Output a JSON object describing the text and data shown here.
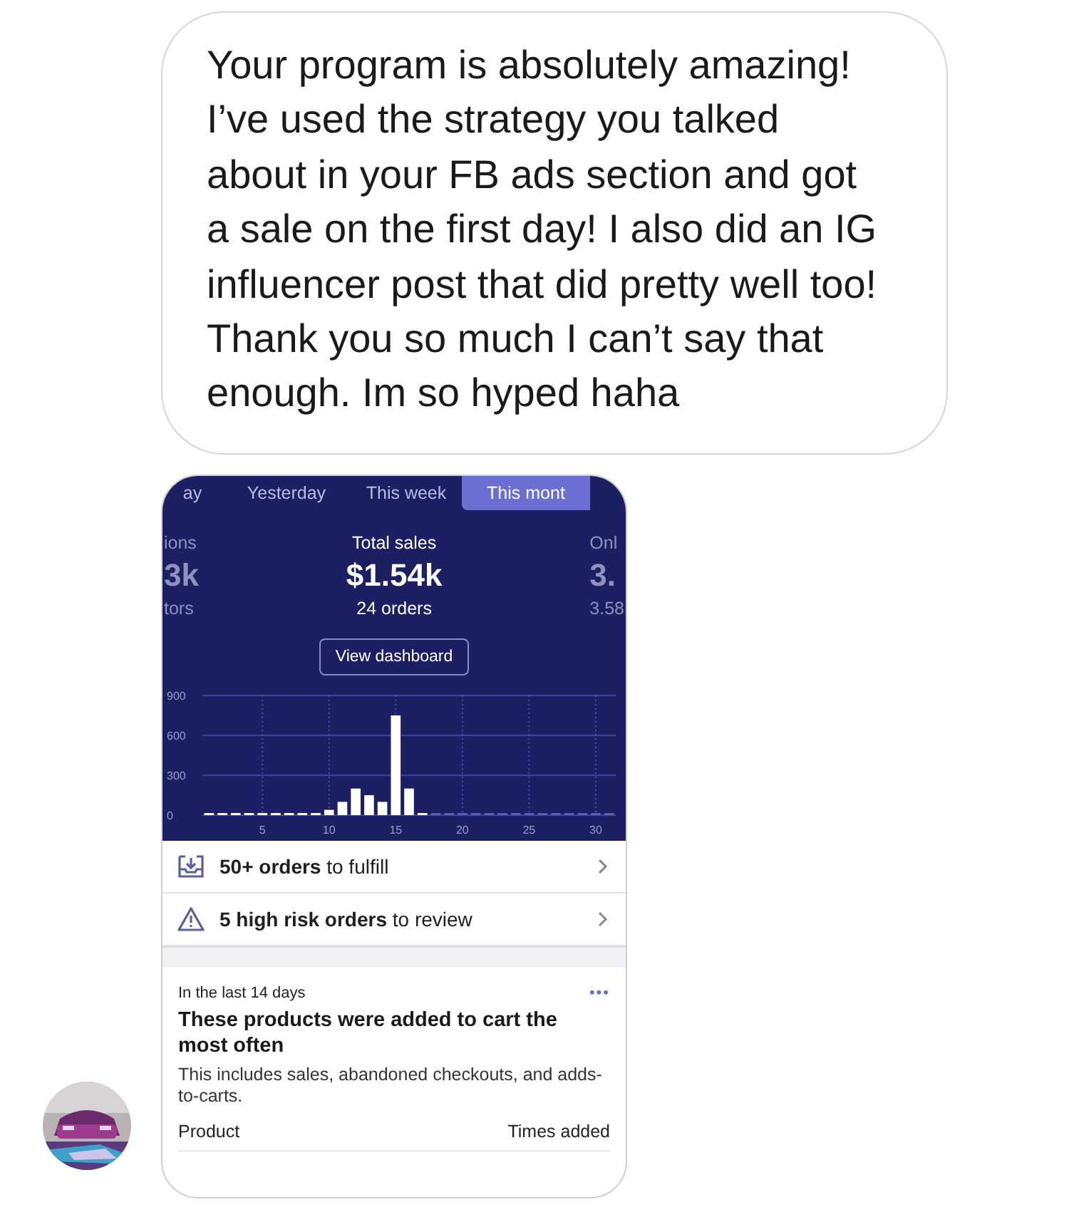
{
  "message": {
    "text": "Your program is absolutely amazing!\nI’ve used the strategy you talked about in your FB ads section and got a sale on the first day! I also did an IG influencer post that did pretty well too! Thank you so much I can’t say that enough. Im so hyped haha"
  },
  "screenshot": {
    "tabs": [
      {
        "label": "ay",
        "selected": false
      },
      {
        "label": "Yesterday",
        "selected": false
      },
      {
        "label": "This week",
        "selected": false
      },
      {
        "label": "This mont",
        "selected": true
      }
    ],
    "metrics": [
      {
        "label": "ions",
        "value": "3k",
        "sub": "tors",
        "faded": true
      },
      {
        "label": "Total sales",
        "value": "$1.54k",
        "sub": "24 orders",
        "faded": false
      },
      {
        "label": "Onl",
        "value": "3.",
        "sub": "3.58",
        "faded": true
      }
    ],
    "dashboard_button": "View dashboard",
    "chart_data": {
      "type": "bar",
      "x": [
        1,
        2,
        3,
        4,
        5,
        6,
        7,
        8,
        9,
        10,
        11,
        12,
        13,
        14,
        15,
        16,
        17,
        18,
        19,
        20,
        21,
        22,
        23,
        24,
        25,
        26,
        27,
        28,
        29,
        30,
        31
      ],
      "values": [
        10,
        10,
        10,
        10,
        10,
        10,
        10,
        10,
        10,
        40,
        100,
        200,
        150,
        100,
        750,
        200,
        10,
        0,
        0,
        0,
        0,
        0,
        0,
        0,
        0,
        0,
        0,
        0,
        0,
        0,
        0
      ],
      "ylim": [
        0,
        900
      ],
      "yticks": [
        0,
        300,
        600,
        900
      ],
      "xticks": [
        5,
        10,
        15,
        20,
        25,
        30
      ],
      "xlim": [
        0.5,
        31.5
      ],
      "grid": true
    },
    "tasks": [
      {
        "kind": "fulfill",
        "text": "**50+ orders** to fulfill"
      },
      {
        "kind": "risk",
        "text": "**5 high risk orders** to review"
      }
    ],
    "card": {
      "eyebrow": "In the last 14 days",
      "more": "•••",
      "title": "These products were added to cart the most often",
      "description": "This includes sales, abandoned checkouts, and adds-to-carts.",
      "columns": [
        "Product",
        "Times added"
      ]
    }
  }
}
